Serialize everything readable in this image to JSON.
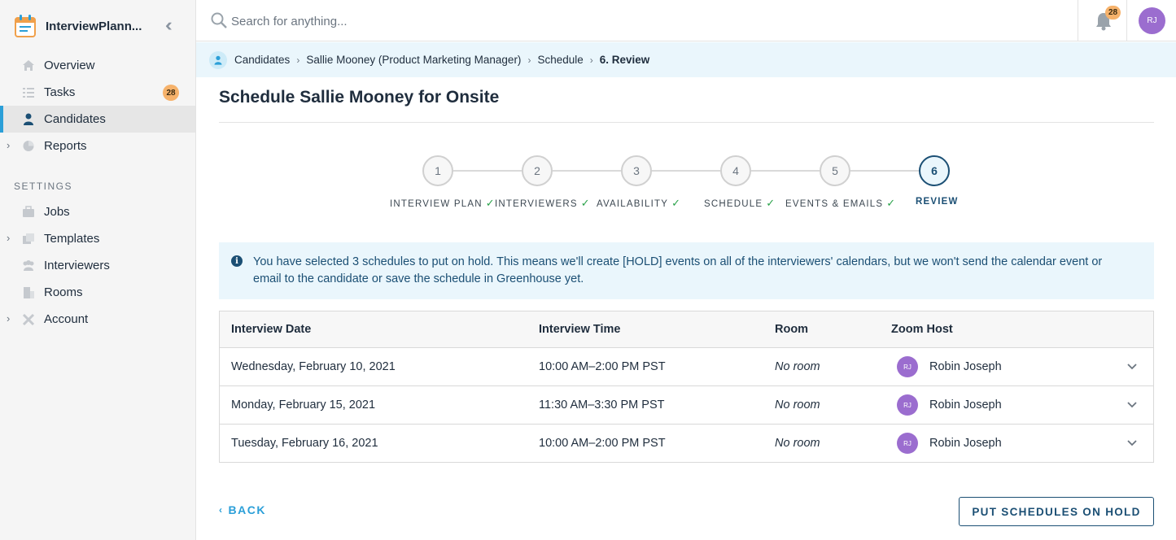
{
  "app": {
    "title": "InterviewPlann..."
  },
  "sidebar": {
    "items": [
      {
        "label": "Overview",
        "icon": "home-icon"
      },
      {
        "label": "Tasks",
        "icon": "list-icon",
        "badge": "28"
      },
      {
        "label": "Candidates",
        "icon": "person-icon",
        "active": true
      },
      {
        "label": "Reports",
        "icon": "pie-chart-icon",
        "expandable": true
      }
    ],
    "settings_label": "SETTINGS",
    "settings_items": [
      {
        "label": "Jobs",
        "icon": "briefcase-icon"
      },
      {
        "label": "Templates",
        "icon": "copy-icon",
        "expandable": true
      },
      {
        "label": "Interviewers",
        "icon": "people-icon"
      },
      {
        "label": "Rooms",
        "icon": "building-icon"
      },
      {
        "label": "Account",
        "icon": "tools-icon",
        "expandable": true
      }
    ]
  },
  "topbar": {
    "search_placeholder": "Search for anything...",
    "notifications_count": "28",
    "avatar_initials": "RJ"
  },
  "breadcrumb": {
    "items": [
      "Candidates",
      "Sallie Mooney (Product Marketing Manager)",
      "Schedule"
    ],
    "current": "6. Review"
  },
  "page": {
    "title": "Schedule Sallie Mooney for Onsite"
  },
  "stepper": {
    "steps": [
      {
        "number": "1",
        "label": "INTERVIEW PLAN",
        "done": true
      },
      {
        "number": "2",
        "label": "INTERVIEWERS",
        "done": true
      },
      {
        "number": "3",
        "label": "AVAILABILITY",
        "done": true
      },
      {
        "number": "4",
        "label": "SCHEDULE",
        "done": true
      },
      {
        "number": "5",
        "label": "EVENTS & EMAILS",
        "done": true
      },
      {
        "number": "6",
        "label": "REVIEW",
        "current": true
      }
    ]
  },
  "info": {
    "text": "You have selected 3 schedules to put on hold. This means we'll create [HOLD] events on all of the interviewers' calendars, but we won't send the calendar event or email to the candidate or save the schedule in Greenhouse yet."
  },
  "table": {
    "headers": [
      "Interview Date",
      "Interview Time",
      "Room",
      "Zoom Host"
    ],
    "rows": [
      {
        "date": "Wednesday, February 10, 2021",
        "time": "10:00 AM–2:00 PM PST",
        "room": "No room",
        "host_initials": "RJ",
        "host": "Robin Joseph"
      },
      {
        "date": "Monday, February 15, 2021",
        "time": "11:30 AM–3:30 PM PST",
        "room": "No room",
        "host_initials": "RJ",
        "host": "Robin Joseph"
      },
      {
        "date": "Tuesday, February 16, 2021",
        "time": "10:00 AM–2:00 PM PST",
        "room": "No room",
        "host_initials": "RJ",
        "host": "Robin Joseph"
      }
    ]
  },
  "footer": {
    "back_label": "BACK",
    "hold_label": "PUT SCHEDULES ON HOLD"
  },
  "colors": {
    "accent": "#2b9fd8",
    "navy": "#1b4f74",
    "badge": "#f6b26b",
    "avatar": "#9b6dcf",
    "success": "#2aa24a"
  }
}
